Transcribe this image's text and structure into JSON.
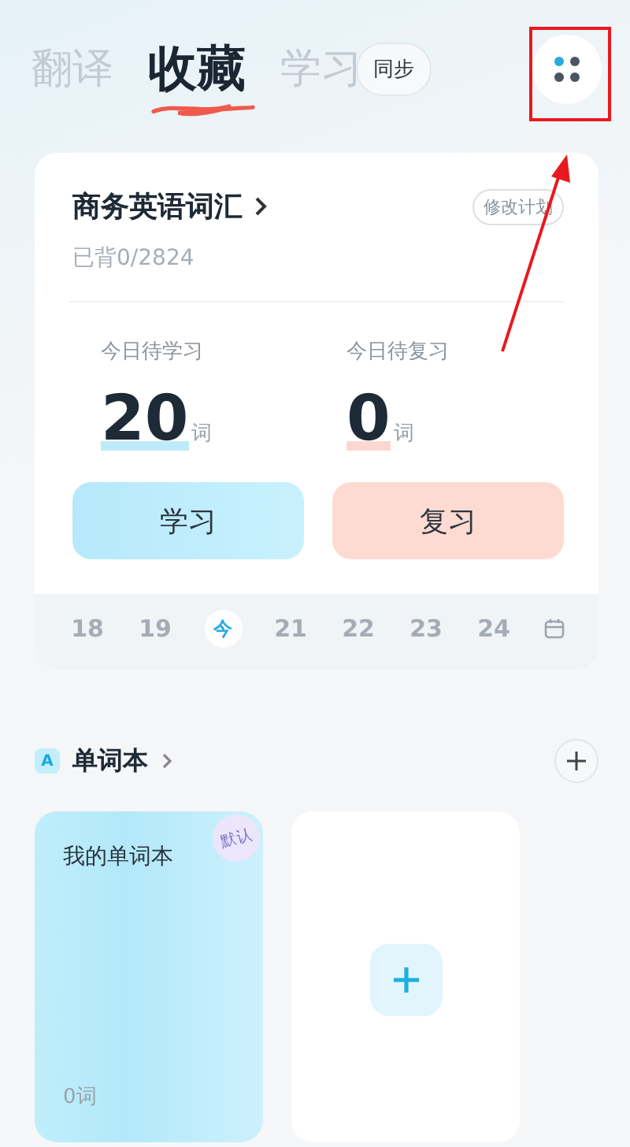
{
  "tabs": [
    {
      "label": "翻译",
      "selected": false
    },
    {
      "label": "收藏",
      "selected": true
    },
    {
      "label": "学习",
      "selected": false
    }
  ],
  "sync_button": "同步",
  "plan_card": {
    "title": "商务英语词汇",
    "edit_button": "修改计划",
    "progress": "已背0/2824",
    "stats": [
      {
        "label": "今日待学习",
        "value": "20",
        "unit": "词",
        "kind": "learn"
      },
      {
        "label": "今日待复习",
        "value": "0",
        "unit": "词",
        "kind": "review"
      }
    ],
    "buttons": [
      {
        "label": "学习",
        "kind": "learn"
      },
      {
        "label": "复习",
        "kind": "review"
      }
    ],
    "dates": [
      {
        "label": "18",
        "selected": false
      },
      {
        "label": "19",
        "selected": false
      },
      {
        "label": "今",
        "selected": true
      },
      {
        "label": "21",
        "selected": false
      },
      {
        "label": "22",
        "selected": false
      },
      {
        "label": "23",
        "selected": false
      },
      {
        "label": "24",
        "selected": false
      }
    ]
  },
  "wordbook_section": {
    "title": "单词本",
    "badge": "A",
    "books": [
      {
        "name": "我的单词本",
        "stamp": "默认",
        "count": "0词"
      }
    ]
  }
}
